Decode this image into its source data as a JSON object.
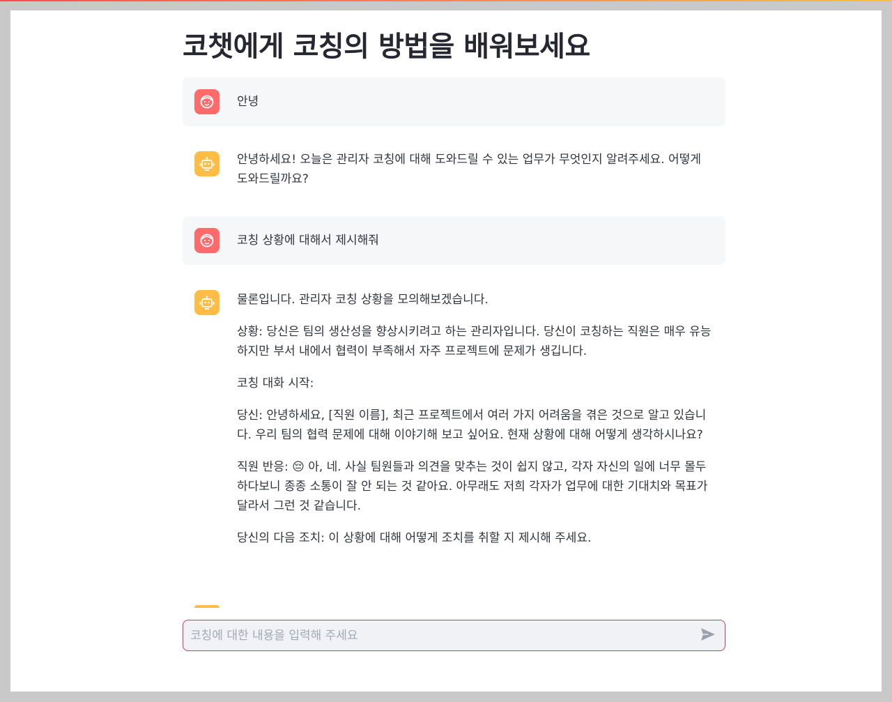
{
  "page": {
    "title": "코챗에게 코칭의 방법을 배워보세요"
  },
  "messages": [
    {
      "role": "user",
      "avatar_icon": "user-face-icon",
      "paragraphs": [
        "안녕"
      ]
    },
    {
      "role": "assistant",
      "avatar_icon": "robot-icon",
      "paragraphs": [
        "안녕하세요! 오늘은 관리자 코칭에 대해 도와드릴 수 있는 업무가 무엇인지 알려주세요. 어떻게 도와드릴까요?"
      ]
    },
    {
      "role": "user",
      "avatar_icon": "user-face-icon",
      "paragraphs": [
        "코칭 상황에 대해서 제시해줘"
      ]
    },
    {
      "role": "assistant",
      "avatar_icon": "robot-icon",
      "paragraphs": [
        "물론입니다. 관리자 코칭 상황을 모의해보겠습니다.",
        "상황: 당신은 팀의 생산성을 향상시키려고 하는 관리자입니다. 당신이 코칭하는 직원은 매우 유능하지만 부서 내에서 협력이 부족해서 자주 프로젝트에 문제가 생깁니다.",
        "코칭 대화 시작:",
        "당신: 안녕하세요, [직원 이름], 최근 프로젝트에서 여러 가지 어려움을 겪은 것으로 알고 있습니다. 우리 팀의 협력 문제에 대해 이야기해 보고 싶어요. 현재 상황에 대해 어떻게 생각하시나요?",
        "직원 반응: 😔 아, 네. 사실 팀원들과 의견을 맞추는 것이 쉽지 않고, 각자 자신의 일에 너무 몰두하다보니 종종 소통이 잘 안 되는 것 같아요. 아무래도 저희 각자가 업무에 대한 기대치와 목표가 달라서 그런 것 같습니다.",
        "당신의 다음 조치: 이 상황에 대해 어떻게 조치를 취할 지 제시해 주세요."
      ]
    }
  ],
  "chat_input": {
    "placeholder": "코칭에 대한 내용을 입력해 주세요",
    "value": "",
    "send_icon": "send-icon"
  },
  "colors": {
    "user_avatar": "#ff6b6b",
    "bot_avatar": "#ffbd45",
    "input_border": "#d1395c"
  }
}
